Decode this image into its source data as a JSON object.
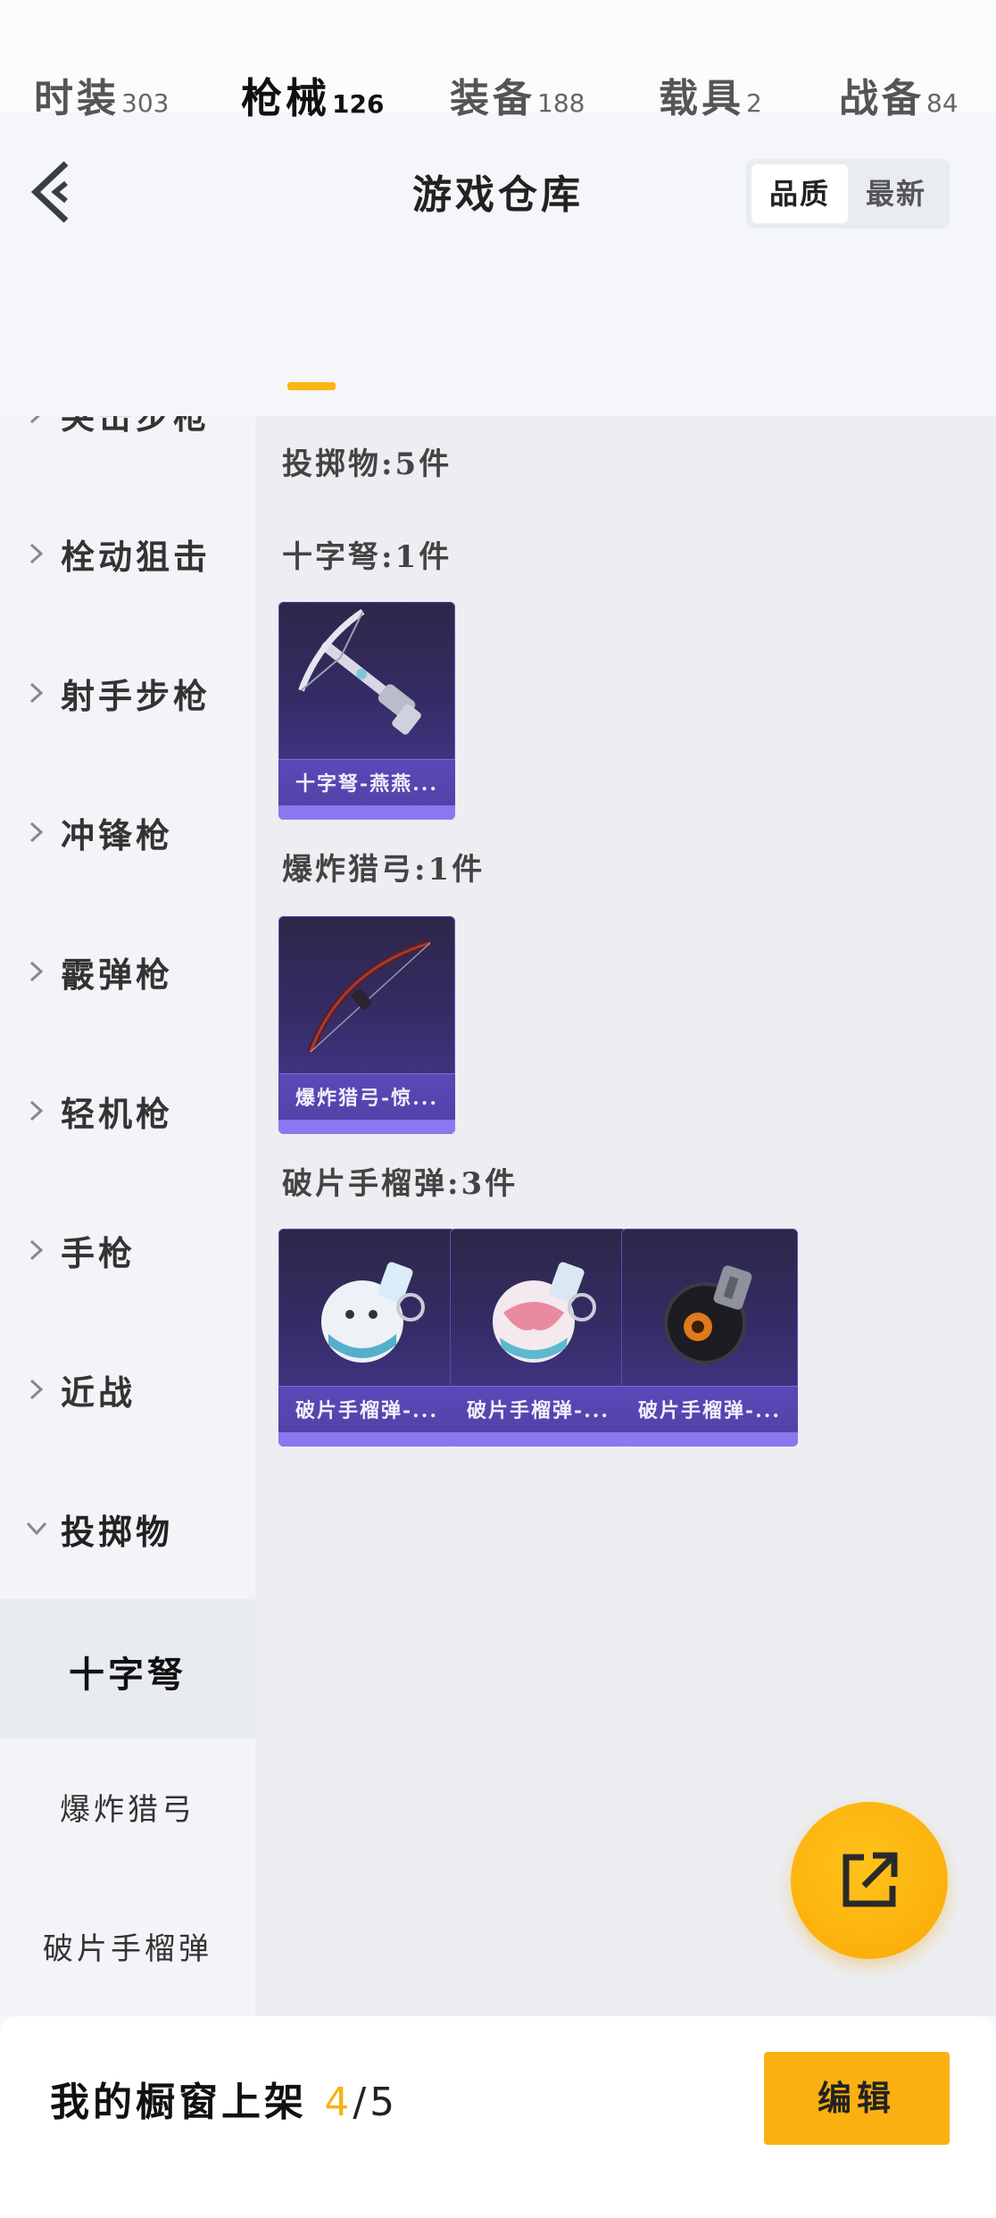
{
  "header": {
    "title": "游戏仓库",
    "sort_options": [
      "品质",
      "最新"
    ],
    "active_sort": "品质"
  },
  "tabs": [
    {
      "label": "时装",
      "count": "303",
      "active": false
    },
    {
      "label": "枪械",
      "count": "126",
      "active": true
    },
    {
      "label": "装备",
      "count": "188",
      "active": false
    },
    {
      "label": "载具",
      "count": "2",
      "active": false
    },
    {
      "label": "战备",
      "count": "84",
      "active": false
    }
  ],
  "sidebar": {
    "partial_top_label": "突击步枪",
    "categories": [
      "栓动狙击",
      "射手步枪",
      "冲锋枪",
      "霰弹枪",
      "轻机枪",
      "手枪",
      "近战",
      "投掷物"
    ],
    "expanded_category": "投掷物",
    "subcategories": [
      "十字弩",
      "爆炸猎弓",
      "破片手榴弹"
    ],
    "selected_subcategory": "十字弩"
  },
  "content": {
    "summary": "投掷物:5件",
    "sections": [
      {
        "title": "十字弩:1件",
        "items": [
          {
            "name": "十字弩-燕燕...",
            "icon": "crossbow-icon"
          }
        ]
      },
      {
        "title": "爆炸猎弓:1件",
        "items": [
          {
            "name": "爆炸猎弓-惊...",
            "icon": "bow-icon"
          }
        ]
      },
      {
        "title": "破片手榴弹:3件",
        "items": [
          {
            "name": "破片手榴弹-...",
            "icon": "grenade-white-icon"
          },
          {
            "name": "破片手榴弹-...",
            "icon": "grenade-pink-icon"
          },
          {
            "name": "破片手榴弹-...",
            "icon": "grenade-black-icon"
          }
        ]
      }
    ]
  },
  "footer": {
    "label": "我的橱窗上架",
    "current": "4",
    "separator": "/",
    "max": "5",
    "edit_label": "编辑"
  },
  "colors": {
    "accent": "#fbb516",
    "card_bg": "#352c66",
    "card_band": "#5b49b8"
  }
}
